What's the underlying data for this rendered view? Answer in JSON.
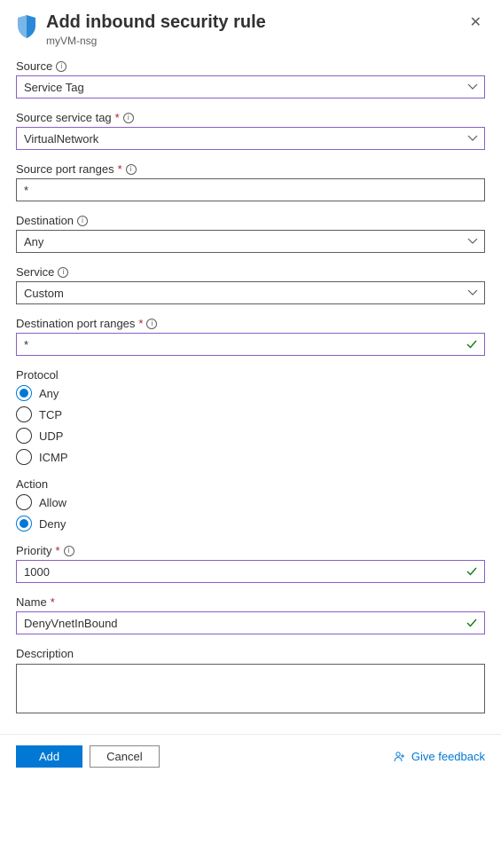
{
  "header": {
    "title": "Add inbound security rule",
    "subtitle": "myVM-nsg"
  },
  "fields": {
    "source": {
      "label": "Source",
      "value": "Service Tag",
      "required": false,
      "info": true
    },
    "source_service_tag": {
      "label": "Source service tag",
      "value": "VirtualNetwork",
      "required": true,
      "info": true
    },
    "source_port_ranges": {
      "label": "Source port ranges",
      "value": "*",
      "required": true,
      "info": true
    },
    "destination": {
      "label": "Destination",
      "value": "Any",
      "required": false,
      "info": true
    },
    "service": {
      "label": "Service",
      "value": "Custom",
      "required": false,
      "info": true
    },
    "destination_port_ranges": {
      "label": "Destination port ranges",
      "value": "*",
      "required": true,
      "info": true
    },
    "protocol": {
      "label": "Protocol",
      "options": [
        "Any",
        "TCP",
        "UDP",
        "ICMP"
      ],
      "selected": "Any"
    },
    "action": {
      "label": "Action",
      "options": [
        "Allow",
        "Deny"
      ],
      "selected": "Deny"
    },
    "priority": {
      "label": "Priority",
      "value": "1000",
      "required": true,
      "info": true
    },
    "name": {
      "label": "Name",
      "value": "DenyVnetInBound",
      "required": true,
      "info": false
    },
    "description": {
      "label": "Description",
      "value": ""
    }
  },
  "footer": {
    "add": "Add",
    "cancel": "Cancel",
    "feedback": "Give feedback"
  }
}
